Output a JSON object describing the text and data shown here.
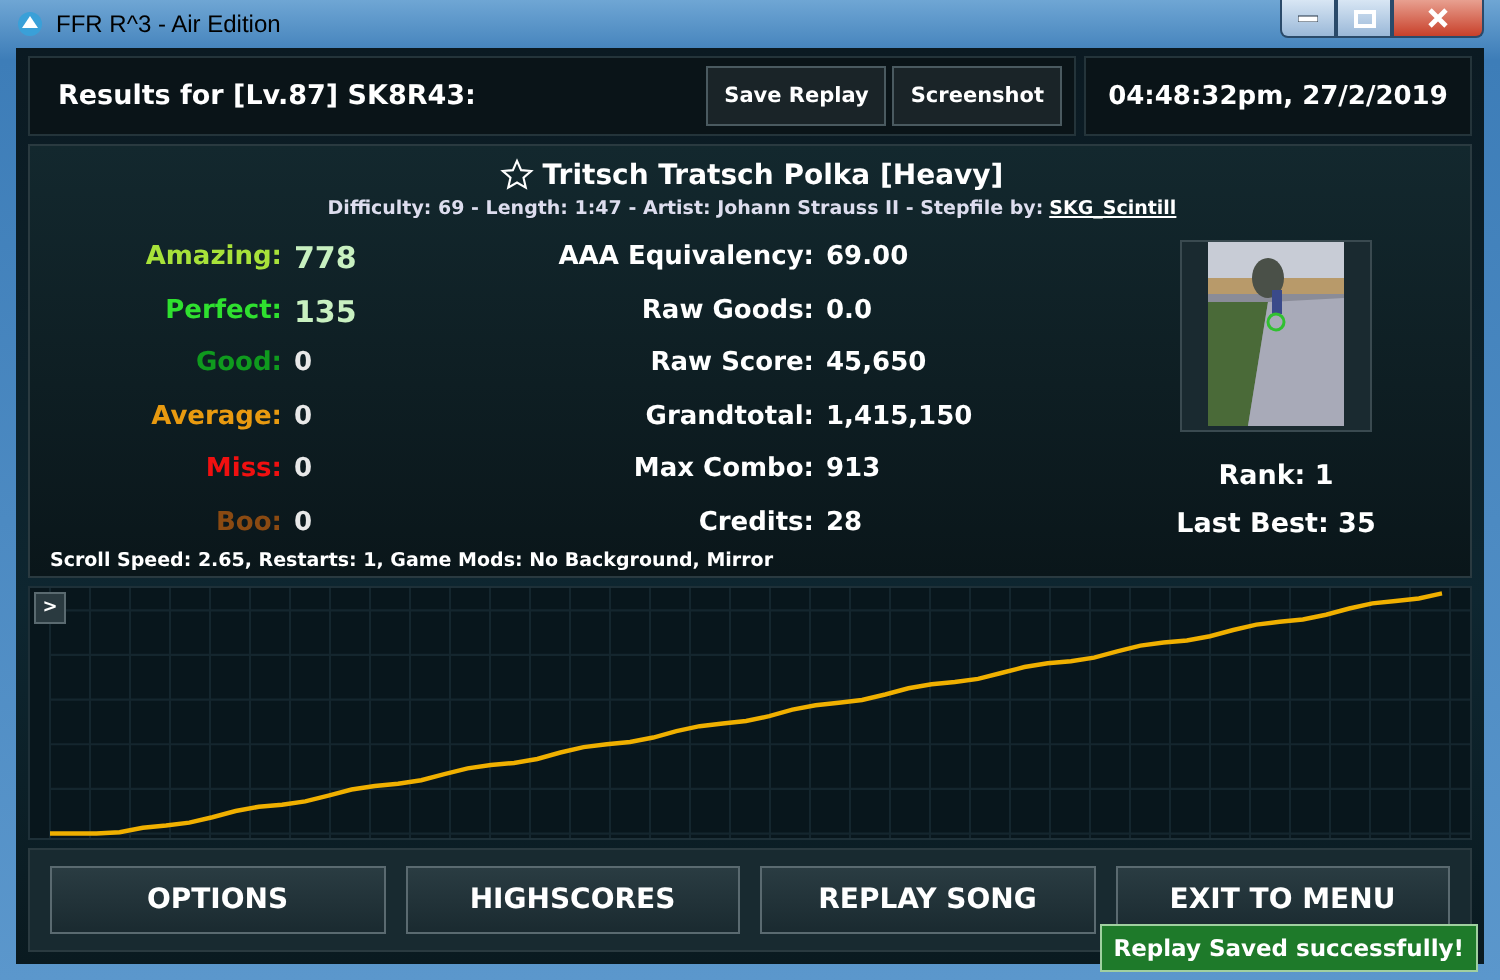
{
  "window": {
    "title": "FFR R^3 - Air Edition"
  },
  "header": {
    "title": "Results for [Lv.87] SK8R43:",
    "buttons": [
      "Save Replay",
      "Screenshot"
    ],
    "datetime": "04:48:32pm, 27/2/2019"
  },
  "song": {
    "title": "Tritsch Tratsch Polka [Heavy]",
    "info": "Difficulty: 69 - Length: 1:47 - Artist: Johann Strauss II - Stepfile by:",
    "stepfile_author": "SKG_Scintill"
  },
  "judgements": [
    {
      "label": "Amazing:",
      "value": "778",
      "color": "#a8e23a"
    },
    {
      "label": "Perfect:",
      "value": "135",
      "color": "#2fe02f"
    },
    {
      "label": "Good:",
      "value": "0",
      "color": "#0f9a1e"
    },
    {
      "label": "Average:",
      "value": "0",
      "color": "#e89a10"
    },
    {
      "label": "Miss:",
      "value": "0",
      "color": "#f01010"
    },
    {
      "label": "Boo:",
      "value": "0",
      "color": "#8a4a12"
    }
  ],
  "stats": [
    {
      "label": "AAA Equivalency:",
      "value": "69.00"
    },
    {
      "label": "Raw Goods:",
      "value": "0.0"
    },
    {
      "label": "Raw Score:",
      "value": "45,650"
    },
    {
      "label": "Grandtotal:",
      "value": "1,415,150"
    },
    {
      "label": "Max Combo:",
      "value": "913"
    },
    {
      "label": "Credits:",
      "value": "28"
    }
  ],
  "rank": "Rank: 1",
  "last_best": "Last Best: 35",
  "settings": "Scroll Speed: 2.65, Restarts: 1, Game Mods: No Background, Mirror",
  "graph": {
    "toggle": ">"
  },
  "buttons": [
    "OPTIONS",
    "HIGHSCORES",
    "REPLAY SONG",
    "EXIT TO MENU"
  ],
  "toast": "Replay Saved successfully!"
}
